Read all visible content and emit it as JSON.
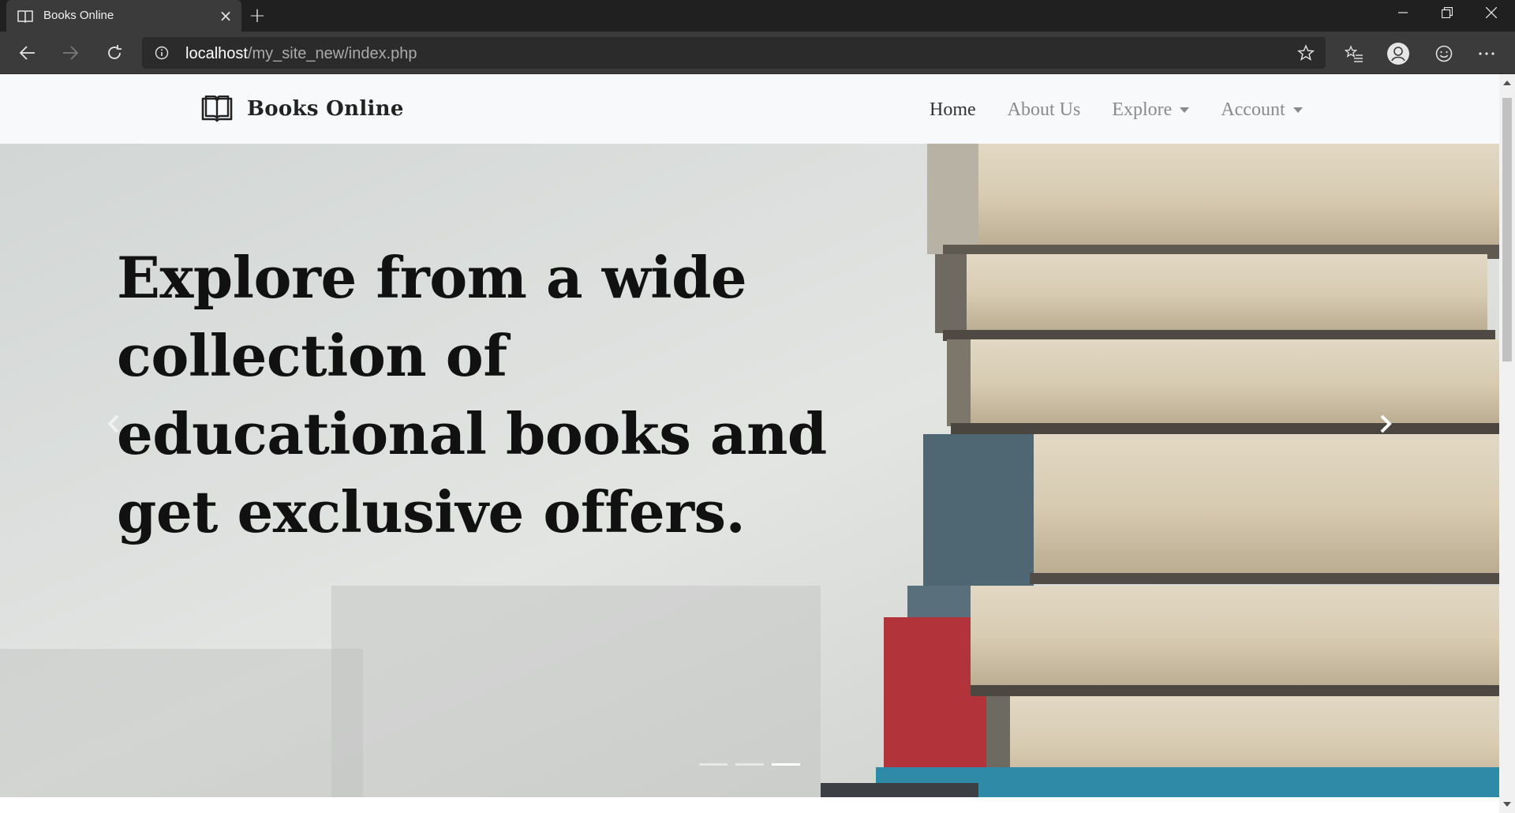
{
  "browser": {
    "tab_title": "Books Online",
    "tab_icon": "book-icon",
    "url_host": "localhost",
    "url_path": "/my_site_new/index.php"
  },
  "site": {
    "brand_name": "Books Online",
    "brand_icon": "open-book-icon",
    "nav": {
      "home": "Home",
      "about": "About Us",
      "explore": "Explore",
      "account": "Account"
    }
  },
  "hero": {
    "headline": "Explore from a wide collection of educational books and get exclusive offers.",
    "slide_count": 3,
    "active_slide": 3
  },
  "colors": {
    "chrome_dark": "#202020",
    "chrome_tab": "#3b3b3b",
    "navbar_bg": "#f8f9fa",
    "nav_active": "#333333",
    "nav_inactive": "#8a8a8a",
    "headline": "#111111"
  }
}
